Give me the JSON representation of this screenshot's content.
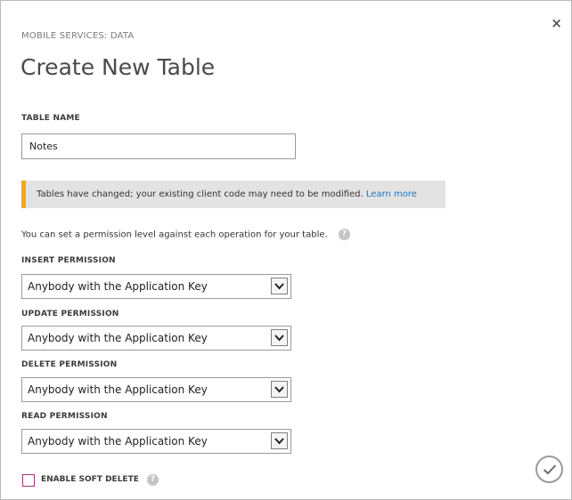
{
  "dialog": {
    "section_label": "MOBILE SERVICES: DATA",
    "title": "Create New Table",
    "close_glyph": "×"
  },
  "table_name": {
    "label": "TABLE NAME",
    "value": "Notes"
  },
  "notice": {
    "text": "Tables have changed; your existing client code may need to be modified.",
    "link": "Learn more",
    "accent_color": "#f5a623"
  },
  "permissions_help": {
    "text": "You can set a permission level against each operation for your table.",
    "icon": "help-icon"
  },
  "permissions": {
    "insert": {
      "label": "INSERT PERMISSION",
      "value": "Anybody with the Application Key"
    },
    "update": {
      "label": "UPDATE PERMISSION",
      "value": "Anybody with the Application Key"
    },
    "delete": {
      "label": "DELETE PERMISSION",
      "value": "Anybody with the Application Key"
    },
    "read": {
      "label": "READ PERMISSION",
      "value": "Anybody with the Application Key"
    }
  },
  "soft_delete": {
    "label": "ENABLE SOFT DELETE",
    "checked": false,
    "icon": "help-icon"
  },
  "confirm": {
    "icon": "checkmark-icon"
  }
}
